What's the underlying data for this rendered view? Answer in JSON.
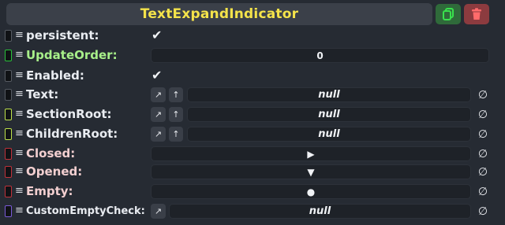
{
  "colors": {
    "title": "#f4e34a",
    "panel_bg": "#262b33",
    "dup_button": "#2f6a3a",
    "delete_button": "#8c3b3f",
    "chip_green": "#29c23a",
    "chip_yellow_green": "#bfe34a",
    "chip_red": "#c0313a",
    "chip_purple": "#7a5ad8",
    "chip_gray": "#555a62"
  },
  "header": {
    "title": "TextExpandIndicator",
    "duplicate_icon": "duplicate-icon",
    "delete_icon": "trash-icon"
  },
  "fields": [
    {
      "label": "persistent:",
      "kind": "bool",
      "checked": true,
      "chip": "gray"
    },
    {
      "label": "UpdateOrder:",
      "kind": "int",
      "value": "0",
      "chip": "green"
    },
    {
      "label": "Enabled:",
      "kind": "bool",
      "checked": true,
      "chip": "gray"
    },
    {
      "label": "Text:",
      "kind": "ref",
      "value": "null",
      "chip": "gray"
    },
    {
      "label": "SectionRoot:",
      "kind": "ref",
      "value": "null",
      "chip": "yellow-green"
    },
    {
      "label": "ChildrenRoot:",
      "kind": "ref",
      "value": "null",
      "chip": "yellow-green"
    },
    {
      "label": "Closed:",
      "kind": "impulse",
      "symbol": "▶",
      "chip": "red"
    },
    {
      "label": "Opened:",
      "kind": "impulse",
      "symbol": "▼",
      "chip": "red"
    },
    {
      "label": "Empty:",
      "kind": "impulse",
      "symbol": "●",
      "chip": "red"
    },
    {
      "label": "CustomEmptyCheck:",
      "kind": "ref",
      "value": "null",
      "chip": "purple"
    }
  ],
  "glyphs": {
    "drag": "≡",
    "check": "✔",
    "jump": "↗",
    "up": "↑",
    "clear": "∅"
  }
}
